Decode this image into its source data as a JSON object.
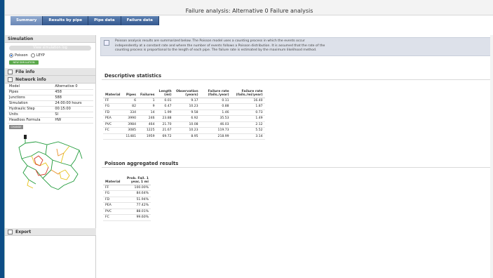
{
  "window": {
    "title": "Failure analysis: Alternative 0 Failure analysis"
  },
  "tabs": [
    {
      "label": "Summary"
    },
    {
      "label": "Results by pipe"
    },
    {
      "label": "Pipe data"
    },
    {
      "label": "Failure data"
    }
  ],
  "sidebar": {
    "simulation_header": "Simulation",
    "view_log": "View simulation log",
    "method_poisson": "Poisson",
    "method_leyp": "LEYP",
    "new_sim": "NEW SIMULATION",
    "file_info": "File info",
    "network_info": "Network info",
    "network": [
      {
        "k": "Model",
        "v": "Alternative 0"
      },
      {
        "k": "Pipes",
        "v": "458"
      },
      {
        "k": "Junctions",
        "v": "588"
      },
      {
        "k": "Simulation",
        "v": "24:00:00 hours"
      },
      {
        "k": "Hydraulic Step",
        "v": "00:15:00"
      },
      {
        "k": "Units",
        "v": "SI"
      },
      {
        "k": "Headloss Formula",
        "v": "HW"
      }
    ],
    "change": "CHANGE",
    "export": "Export"
  },
  "info_text": "Poisson analysis results are summarized below. The Poisson model uses a counting process in which the events occur independently at a constant rate and where the number of events follows a Poisson distribution. It is assumed that the rate of the counting process is proportional to the length of each pipe. The failure rate is estimated by the maximum likelihood method.",
  "descriptive": {
    "title": "Descriptive statistics",
    "headers": [
      "Material",
      "Pipes",
      "Failures",
      "Length (mi)",
      "Observation (years)",
      "Failure rate (fails./year)",
      "Failure rate (fails./mi/year)"
    ],
    "rows": [
      [
        "FF",
        "6",
        "1",
        "0.01",
        "9.17",
        "0.11",
        "16.40"
      ],
      [
        "FG",
        "82",
        "9",
        "0.47",
        "10.23",
        "0.88",
        "1.87"
      ],
      [
        "FD",
        "334",
        "14",
        "1.99",
        "9.58",
        "1.46",
        "0.73"
      ],
      [
        "PEA",
        "3990",
        "246",
        "23.88",
        "6.92",
        "35.53",
        "1.49"
      ],
      [
        "PVC",
        "3984",
        "464",
        "21.70",
        "10.08",
        "46.03",
        "2.12"
      ],
      [
        "FC",
        "3085",
        "1225",
        "21.67",
        "10.23",
        "119.73",
        "5.52"
      ],
      [
        "",
        "11481",
        "1959",
        "69.72",
        "8.95",
        "218.99",
        "3.14"
      ]
    ]
  },
  "aggregated": {
    "title": "Poisson aggregated results",
    "headers": [
      "Material",
      "Prob. Fail. 1 year, 1 mi"
    ],
    "rows": [
      [
        "FF",
        "100.00%"
      ],
      [
        "FG",
        "84.64%"
      ],
      [
        "FD",
        "51.94%"
      ],
      [
        "PEA",
        "77.42%"
      ],
      [
        "PVC",
        "88.01%"
      ],
      [
        "FC",
        "99.60%"
      ]
    ]
  }
}
